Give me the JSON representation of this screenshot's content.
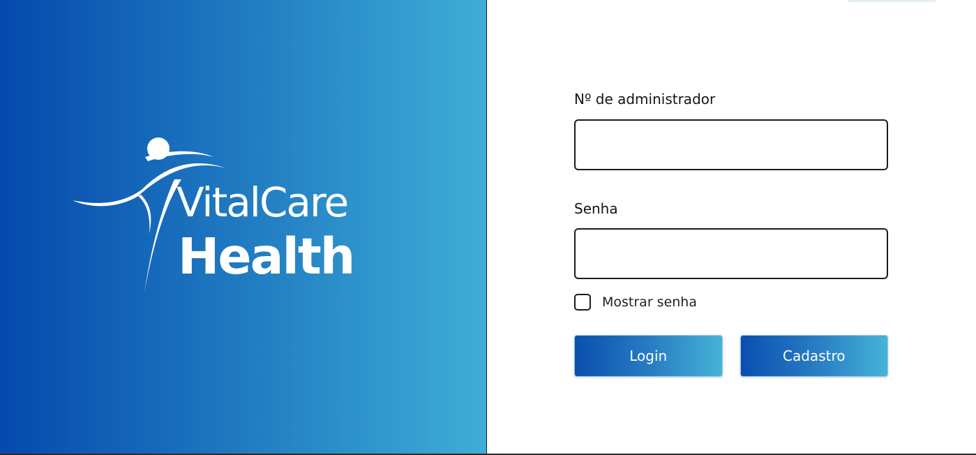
{
  "brand": {
    "name_line1": "VitalCare",
    "name_line2": "Health",
    "logo_icon": "runner-figure-icon",
    "gradient_start": "#0549ad",
    "gradient_end": "#3fadd6"
  },
  "form": {
    "admin_label": "Nº de administrador",
    "admin_value": "",
    "password_label": "Senha",
    "password_value": "",
    "show_password_label": "Mostrar senha",
    "show_password_checked": false,
    "login_button": "Login",
    "register_button": "Cadastro"
  }
}
